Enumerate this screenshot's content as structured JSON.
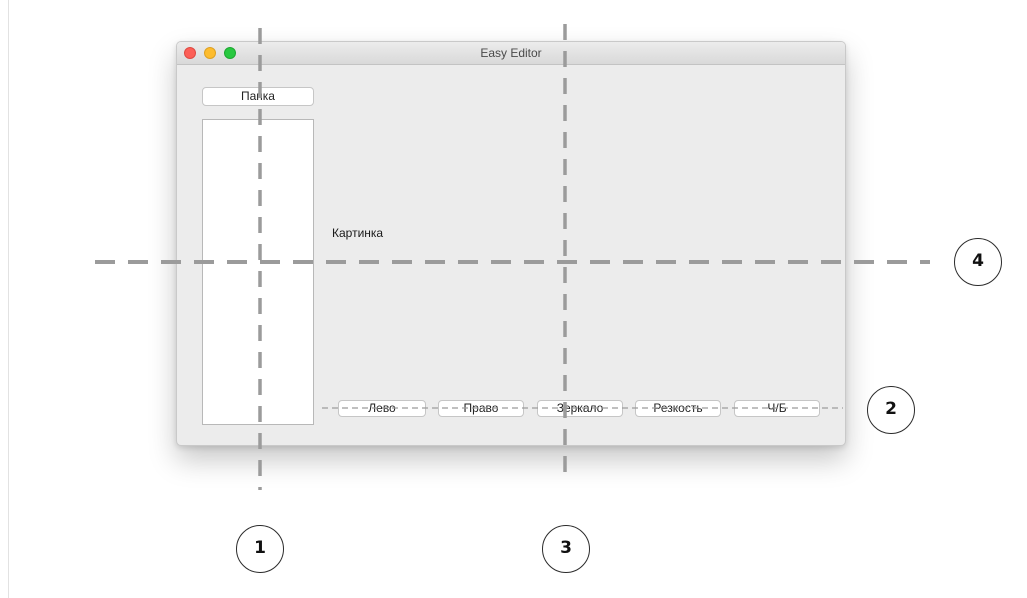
{
  "window": {
    "title": "Easy Editor"
  },
  "sidebar": {
    "folder_button": "Папка"
  },
  "main": {
    "picture_label": "Картинка"
  },
  "toolbar": {
    "buttons": [
      "Лево",
      "Право",
      "Зеркало",
      "Резкость",
      "Ч/Б"
    ]
  },
  "annotations": {
    "markers": [
      "1",
      "2",
      "3",
      "4"
    ]
  },
  "colors": {
    "close": "#fc5f57",
    "minimize": "#fdbc2e",
    "maximize": "#28c840",
    "guide_lines": "#9b9b9b",
    "window_background": "#ececec"
  }
}
